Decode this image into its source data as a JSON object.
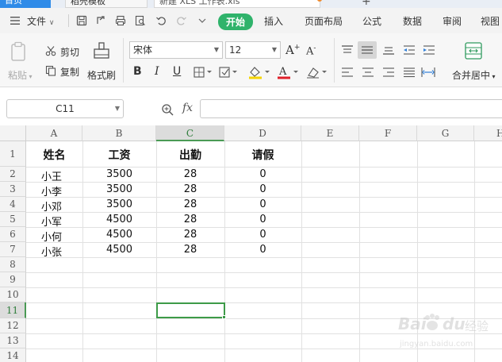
{
  "tabs": [
    {
      "label": "首页"
    },
    {
      "label": "稻壳模板"
    },
    {
      "label": "新建 XLS 工作表.xls"
    }
  ],
  "menubar": {
    "file_label": "文件",
    "items": [
      "开始",
      "插入",
      "页面布局",
      "公式",
      "数据",
      "审阅",
      "视图"
    ],
    "active_index": 0
  },
  "ribbon": {
    "paste": "粘贴",
    "cut": "剪切",
    "copy": "复制",
    "format_painter": "格式刷",
    "font_name": "宋体",
    "font_size": "12",
    "merge_center": "合并居中",
    "bold": "B",
    "italic": "I",
    "underline": "U",
    "grow_font": "A",
    "shrink_font": "A",
    "font_color": "A"
  },
  "formula_bar": {
    "name_box": "C11",
    "fx": "fx",
    "formula": ""
  },
  "sheet": {
    "columns": [
      "A",
      "B",
      "C",
      "D",
      "E",
      "F",
      "G",
      "H"
    ],
    "rows": [
      "1",
      "2",
      "3",
      "4",
      "5",
      "6",
      "7",
      "8",
      "9",
      "10",
      "11",
      "12",
      "13",
      "14"
    ],
    "headers": [
      "姓名",
      "工资",
      "出勤",
      "请假"
    ],
    "data": [
      [
        "小王",
        "3500",
        "28",
        "0"
      ],
      [
        "小李",
        "3500",
        "28",
        "0"
      ],
      [
        "小邓",
        "3500",
        "28",
        "0"
      ],
      [
        "小军",
        "4500",
        "28",
        "0"
      ],
      [
        "小何",
        "4500",
        "28",
        "0"
      ],
      [
        "小张",
        "4500",
        "28",
        "0"
      ]
    ],
    "active_cell": "C11",
    "selected_column": "C",
    "selected_row": "11"
  },
  "watermark": {
    "brand": "Bai",
    "brand2": "du",
    "cn": "经验",
    "url": "jingyan.baidu.com"
  },
  "colors": {
    "accent_green": "#2fb36b",
    "selection_green": "#3d9b48"
  }
}
